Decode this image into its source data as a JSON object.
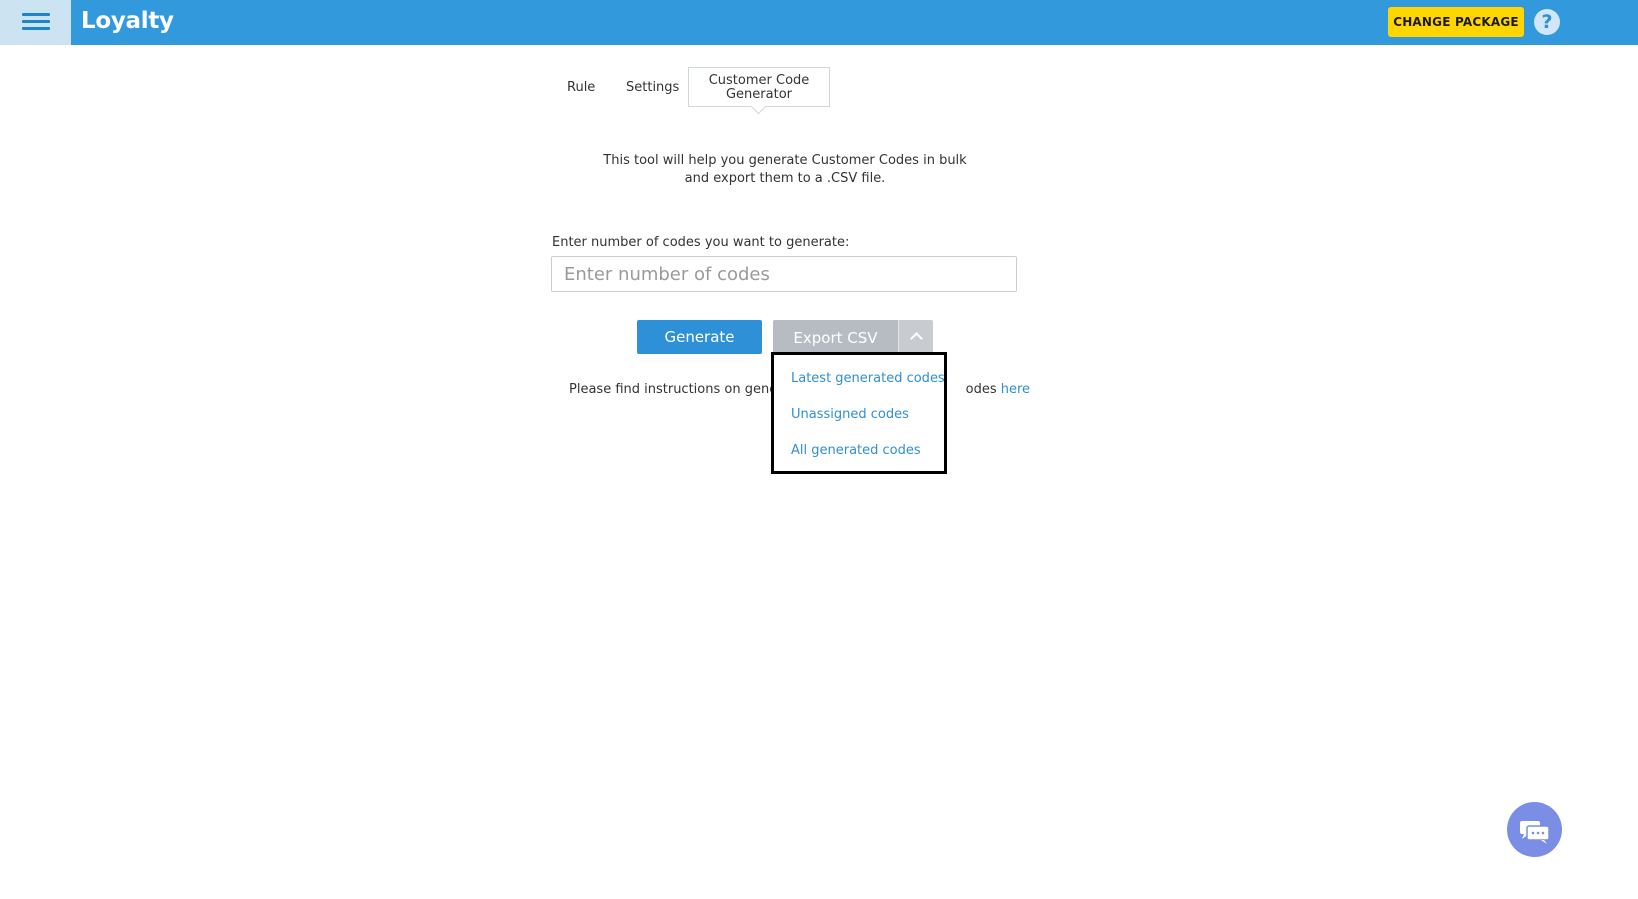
{
  "header": {
    "app_title": "Loyalty",
    "change_package_label": "CHANGE PACKAGE",
    "help_icon_glyph": "?",
    "accent_color": "#3199dc",
    "button_color": "#ffd600"
  },
  "tabs": [
    {
      "label": "Rule",
      "active": false
    },
    {
      "label": "Settings",
      "active": false
    },
    {
      "label": "Customer Code Generator",
      "active": true
    }
  ],
  "main": {
    "intro": "This tool will help you generate Customer Codes in bulk and export them to a .CSV file.",
    "input_label": "Enter number of codes you want to generate:",
    "input_placeholder": "Enter number of codes",
    "input_value": "",
    "generate_label": "Generate",
    "export_label": "Export CSV",
    "instructions_prefix": "Please find instructions on generat",
    "instructions_suffix": "odes ",
    "instructions_link": "here"
  },
  "dropdown": {
    "items": [
      {
        "label": "Latest generated codes"
      },
      {
        "label": "Unassigned codes"
      },
      {
        "label": "All generated codes"
      }
    ]
  },
  "chat": {
    "icon": "chat-icon",
    "color": "#7a8ee6"
  }
}
